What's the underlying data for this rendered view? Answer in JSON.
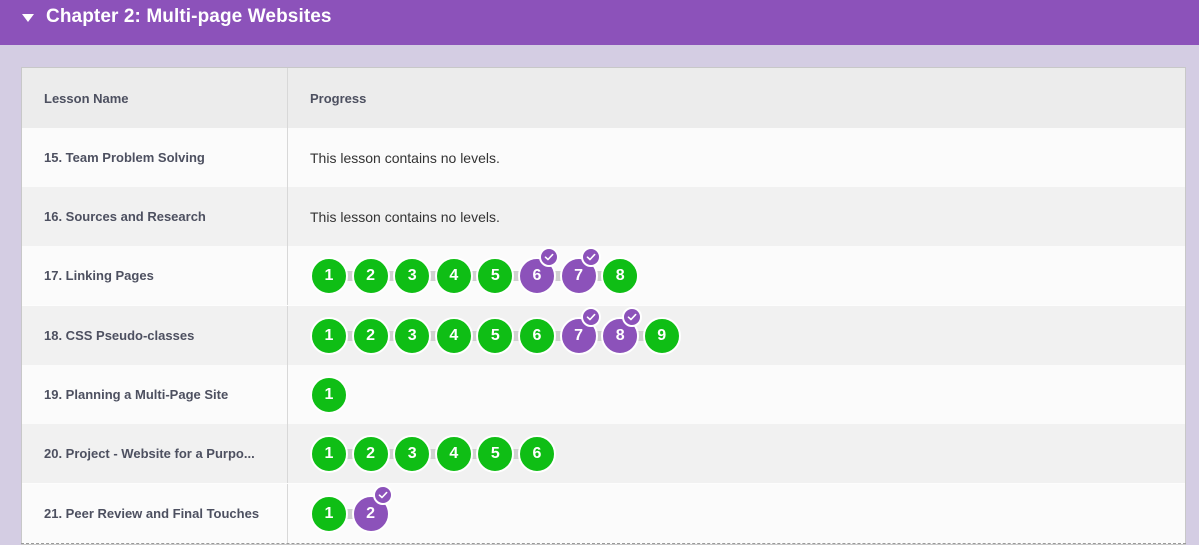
{
  "header": {
    "title": "Chapter 2: Multi-page Websites"
  },
  "table": {
    "columns": [
      "Lesson Name",
      "Progress"
    ],
    "rows": [
      {
        "name": "15. Team Problem Solving",
        "no_levels_text": "This lesson contains no levels.",
        "levels": []
      },
      {
        "name": "16. Sources and Research",
        "no_levels_text": "This lesson contains no levels.",
        "levels": []
      },
      {
        "name": "17. Linking Pages",
        "levels": [
          {
            "label": "1",
            "status": "green",
            "checked": false
          },
          {
            "label": "2",
            "status": "green",
            "checked": false
          },
          {
            "label": "3",
            "status": "green",
            "checked": false
          },
          {
            "label": "4",
            "status": "green",
            "checked": false
          },
          {
            "label": "5",
            "status": "green",
            "checked": false
          },
          {
            "label": "6",
            "status": "purple",
            "checked": true
          },
          {
            "label": "7",
            "status": "purple",
            "checked": true
          },
          {
            "label": "8",
            "status": "green",
            "checked": false
          }
        ]
      },
      {
        "name": "18. CSS Pseudo-classes",
        "levels": [
          {
            "label": "1",
            "status": "green",
            "checked": false
          },
          {
            "label": "2",
            "status": "green",
            "checked": false
          },
          {
            "label": "3",
            "status": "green",
            "checked": false
          },
          {
            "label": "4",
            "status": "green",
            "checked": false
          },
          {
            "label": "5",
            "status": "green",
            "checked": false
          },
          {
            "label": "6",
            "status": "green",
            "checked": false
          },
          {
            "label": "7",
            "status": "purple",
            "checked": true
          },
          {
            "label": "8",
            "status": "purple",
            "checked": true
          },
          {
            "label": "9",
            "status": "green",
            "checked": false
          }
        ]
      },
      {
        "name": "19. Planning a Multi-Page Site",
        "levels": [
          {
            "label": "1",
            "status": "green",
            "checked": false
          }
        ]
      },
      {
        "name": "20. Project - Website for a Purpo...",
        "levels": [
          {
            "label": "1",
            "status": "green",
            "checked": false
          },
          {
            "label": "2",
            "status": "green",
            "checked": false
          },
          {
            "label": "3",
            "status": "green",
            "checked": false
          },
          {
            "label": "4",
            "status": "green",
            "checked": false
          },
          {
            "label": "5",
            "status": "green",
            "checked": false
          },
          {
            "label": "6",
            "status": "green",
            "checked": false
          }
        ]
      },
      {
        "name": "21. Peer Review and Final Touches",
        "levels": [
          {
            "label": "1",
            "status": "green",
            "checked": false
          },
          {
            "label": "2",
            "status": "purple",
            "checked": true
          }
        ]
      }
    ]
  },
  "colors": {
    "accent": "#8c52ba",
    "complete": "#0fbe15",
    "background": "#d4cde3"
  }
}
